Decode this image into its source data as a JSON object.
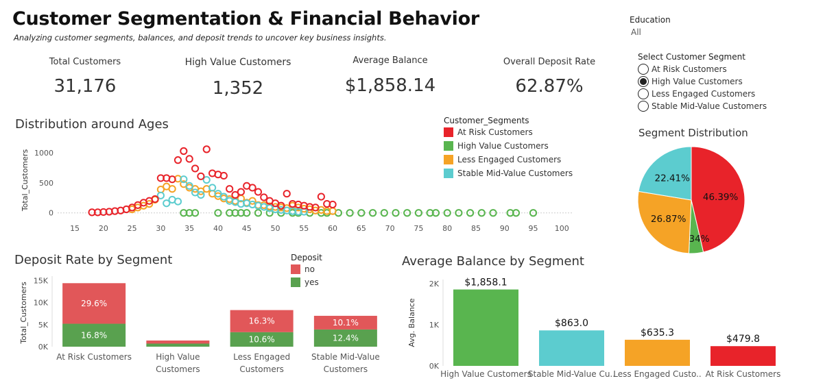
{
  "header": {
    "title": "Customer Segmentation & Financial Behavior",
    "subtitle": "Analyzing customer segments, balances, and deposit trends to uncover key business insights."
  },
  "kpis": [
    {
      "label": "Total Customers",
      "value": "31,176"
    },
    {
      "label": "High Value Customers",
      "value": "1,352"
    },
    {
      "label": "Average Balance",
      "value": "$1,858.14"
    },
    {
      "label": "Overall Deposit Rate",
      "value": "62.87%"
    }
  ],
  "filters": {
    "education_label": "Education",
    "education_value": "All",
    "segment_label": "Select Customer Segment",
    "segment_options": [
      "At Risk Customers",
      "High Value Customers",
      "Less Engaged Customers",
      "Stable Mid-Value Customers"
    ],
    "segment_selected": "High Value Customers"
  },
  "colors": {
    "at_risk": "#e8232a",
    "high_value": "#59b54f",
    "less_engaged": "#f5a326",
    "stable_mid": "#5ccccf",
    "deposit_no": "#e15759",
    "deposit_yes": "#59a14f"
  },
  "chart_data": [
    {
      "id": "ages",
      "type": "scatter",
      "title": "Distribution around Ages",
      "xlabel": "",
      "ylabel": "Total_Customers",
      "xlim": [
        12,
        102
      ],
      "ylim": [
        -60,
        1150
      ],
      "xticks": [
        15,
        20,
        25,
        30,
        35,
        40,
        45,
        50,
        55,
        60,
        65,
        70,
        75,
        80,
        85,
        90,
        95,
        100
      ],
      "yticks": [
        0,
        500,
        1000
      ],
      "legend_title": "Customer_Segments",
      "legend_position": "right",
      "series": [
        {
          "name": "At Risk Customers",
          "color": "#e8232a",
          "x": [
            18,
            19,
            20,
            21,
            22,
            23,
            24,
            25,
            26,
            27,
            28,
            29,
            30,
            31,
            32,
            33,
            34,
            35,
            36,
            37,
            38,
            39,
            40,
            41,
            42,
            43,
            44,
            45,
            46,
            47,
            48,
            49,
            50,
            51,
            52,
            53,
            54,
            55,
            56,
            57,
            58,
            59,
            60
          ],
          "y": [
            10,
            10,
            15,
            20,
            30,
            40,
            60,
            90,
            130,
            170,
            200,
            230,
            580,
            580,
            560,
            880,
            1030,
            900,
            740,
            610,
            1060,
            660,
            640,
            620,
            400,
            300,
            350,
            450,
            420,
            350,
            260,
            200,
            160,
            120,
            320,
            150,
            140,
            120,
            100,
            90,
            270,
            150,
            140
          ]
        },
        {
          "name": "High Value Customers",
          "color": "#59b54f",
          "x": [
            34,
            35,
            36,
            40,
            42,
            43,
            44,
            45,
            47,
            49,
            51,
            53,
            54,
            56,
            58,
            59,
            61,
            63,
            65,
            67,
            69,
            71,
            73,
            75,
            77,
            78,
            80,
            82,
            84,
            86,
            88,
            91,
            92,
            95
          ],
          "y": [
            0,
            0,
            0,
            0,
            0,
            0,
            0,
            0,
            0,
            0,
            0,
            0,
            0,
            0,
            0,
            0,
            0,
            0,
            0,
            0,
            0,
            0,
            0,
            0,
            0,
            0,
            0,
            0,
            0,
            0,
            0,
            0,
            0,
            0
          ]
        },
        {
          "name": "Less Engaged Customers",
          "color": "#f5a326",
          "x": [
            25,
            26,
            27,
            28,
            29,
            30,
            31,
            32,
            33,
            34,
            35,
            36,
            37,
            38,
            39,
            40,
            41,
            42,
            43,
            44,
            45,
            46,
            47,
            48,
            49,
            50,
            51,
            52,
            53,
            54,
            55,
            56,
            57,
            58,
            59,
            60
          ],
          "y": [
            60,
            90,
            120,
            150,
            220,
            390,
            440,
            400,
            570,
            480,
            420,
            400,
            360,
            400,
            320,
            280,
            240,
            230,
            200,
            240,
            170,
            200,
            130,
            130,
            110,
            100,
            90,
            80,
            120,
            90,
            70,
            60,
            40,
            50,
            30,
            30
          ]
        },
        {
          "name": "Stable Mid-Value Customers",
          "color": "#5ccccf",
          "x": [
            30,
            31,
            32,
            33,
            34,
            35,
            36,
            37,
            38,
            39,
            40,
            41,
            42,
            43,
            44,
            45,
            46,
            47,
            48,
            49,
            50,
            51,
            52,
            53,
            54,
            55
          ],
          "y": [
            290,
            160,
            220,
            190,
            560,
            450,
            340,
            300,
            550,
            420,
            320,
            270,
            200,
            180,
            150,
            160,
            140,
            120,
            100,
            80,
            60,
            50,
            40,
            30,
            20,
            20
          ]
        }
      ]
    },
    {
      "id": "deposit",
      "type": "bar",
      "stacked": true,
      "title": "Deposit Rate by Segment",
      "xlabel": "",
      "ylabel": "Total_Customers",
      "ylim": [
        0,
        16000
      ],
      "yticks": [
        0,
        5000,
        10000,
        15000
      ],
      "ytick_labels": [
        "0K",
        "5K",
        "10K",
        "15K"
      ],
      "categories": [
        "At Risk Customers",
        "High Value Customers",
        "Less Engaged Customers",
        "Stable Mid-Value Customers"
      ],
      "category_lines": [
        [
          "At Risk Customers"
        ],
        [
          "High Value",
          "Customers"
        ],
        [
          "Less Engaged",
          "Customers"
        ],
        [
          "Stable Mid-Value",
          "Customers"
        ]
      ],
      "legend_title": "Deposit",
      "legend_position": "top",
      "series": [
        {
          "name": "yes",
          "color": "#59a14f",
          "values": [
            5200,
            700,
            3300,
            3900
          ],
          "labels": [
            "16.8%",
            "",
            "10.6%",
            "12.4%"
          ]
        },
        {
          "name": "no",
          "color": "#e15759",
          "values": [
            9200,
            700,
            5000,
            3100
          ],
          "labels": [
            "29.6%",
            "",
            "16.3%",
            "10.1%"
          ]
        }
      ]
    },
    {
      "id": "balance",
      "type": "bar",
      "title": "Average Balance by Segment",
      "xlabel": "",
      "ylabel": "Avg. Balance",
      "ylim": [
        0,
        2100
      ],
      "yticks": [
        0,
        1000,
        2000
      ],
      "ytick_labels": [
        "0K",
        "1K",
        "2K"
      ],
      "categories": [
        "High Value Customers",
        "Stable Mid-Value Cu..",
        "Less Engaged Custo..",
        "At Risk Customers"
      ],
      "values": [
        1858.1,
        863.0,
        635.3,
        479.8
      ],
      "value_labels": [
        "$1,858.1",
        "$863.0",
        "$635.3",
        "$479.8"
      ],
      "colors": [
        "#59b54f",
        "#5ccccf",
        "#f5a326",
        "#e8232a"
      ]
    },
    {
      "id": "pie",
      "type": "pie",
      "title": "Segment Distribution",
      "slices": [
        {
          "name": "At Risk Customers",
          "value": 46.39,
          "label": "46.39%",
          "color": "#e8232a"
        },
        {
          "name": "High Value Customers",
          "value": 4.34,
          "label": "4.34%",
          "color": "#59b54f"
        },
        {
          "name": "Less Engaged Customers",
          "value": 26.87,
          "label": "26.87%",
          "color": "#f5a326"
        },
        {
          "name": "Stable Mid-Value Customers",
          "value": 22.41,
          "label": "22.41%",
          "color": "#5ccccf"
        }
      ]
    }
  ]
}
